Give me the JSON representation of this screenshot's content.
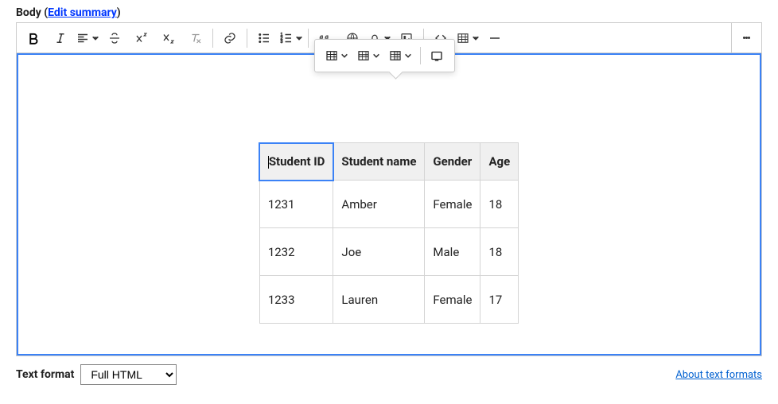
{
  "field": {
    "label": "Body",
    "edit_link": "Edit summary"
  },
  "toolbar": {
    "bold": "Bold",
    "italic": "Italic",
    "align": "Alignment",
    "strike": "Strikethrough",
    "sup": "Superscript",
    "sub": "Subscript",
    "clear": "Remove format",
    "link": "Link",
    "ul": "Bulleted list",
    "ol": "Numbered list",
    "quote": "Block quote",
    "lang": "Language",
    "special": "Special characters",
    "image": "Insert image",
    "source": "Source",
    "table": "Table",
    "hr": "Horizontal line",
    "more": "More"
  },
  "popup": {
    "table_props": "Table properties",
    "row_props": "Row properties",
    "col_props": "Column",
    "fullscreen": "Maximize"
  },
  "table": {
    "headers": [
      "Student ID",
      "Student name",
      "Gender",
      "Age"
    ],
    "rows": [
      [
        "1231",
        "Amber",
        "Female",
        "18"
      ],
      [
        "1232",
        "Joe",
        "Male",
        "18"
      ],
      [
        "1233",
        "Lauren",
        "Female",
        "17"
      ]
    ]
  },
  "footer": {
    "label": "Text format",
    "selected": "Full HTML",
    "about": "About text formats"
  }
}
